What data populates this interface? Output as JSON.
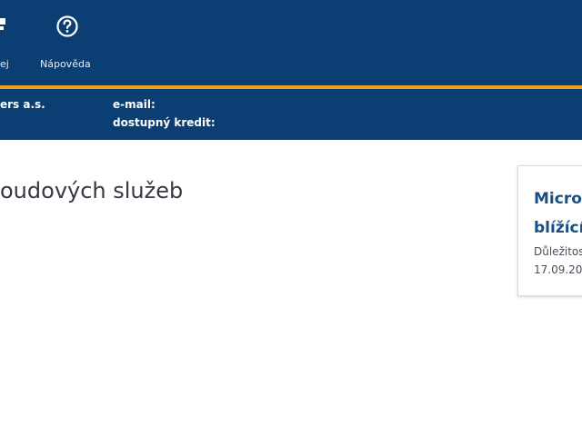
{
  "nav": {
    "items": [
      {
        "label": "ej",
        "icon": "cart-icon"
      },
      {
        "label": "Nápověda",
        "icon": "help-circle-icon"
      }
    ]
  },
  "info": {
    "company": "ers a.s.",
    "email_label": "e-mail:",
    "credit_label": "dostupný kredit:"
  },
  "main": {
    "title": "oudových služeb"
  },
  "news": {
    "title_line1": "Micro",
    "title_line2": "blížící",
    "category": "Důležitos",
    "date": "17.09.20"
  },
  "colors": {
    "header_bg": "#0b3f73",
    "accent_line": "#e8a21b",
    "news_title": "#1a4f86"
  }
}
